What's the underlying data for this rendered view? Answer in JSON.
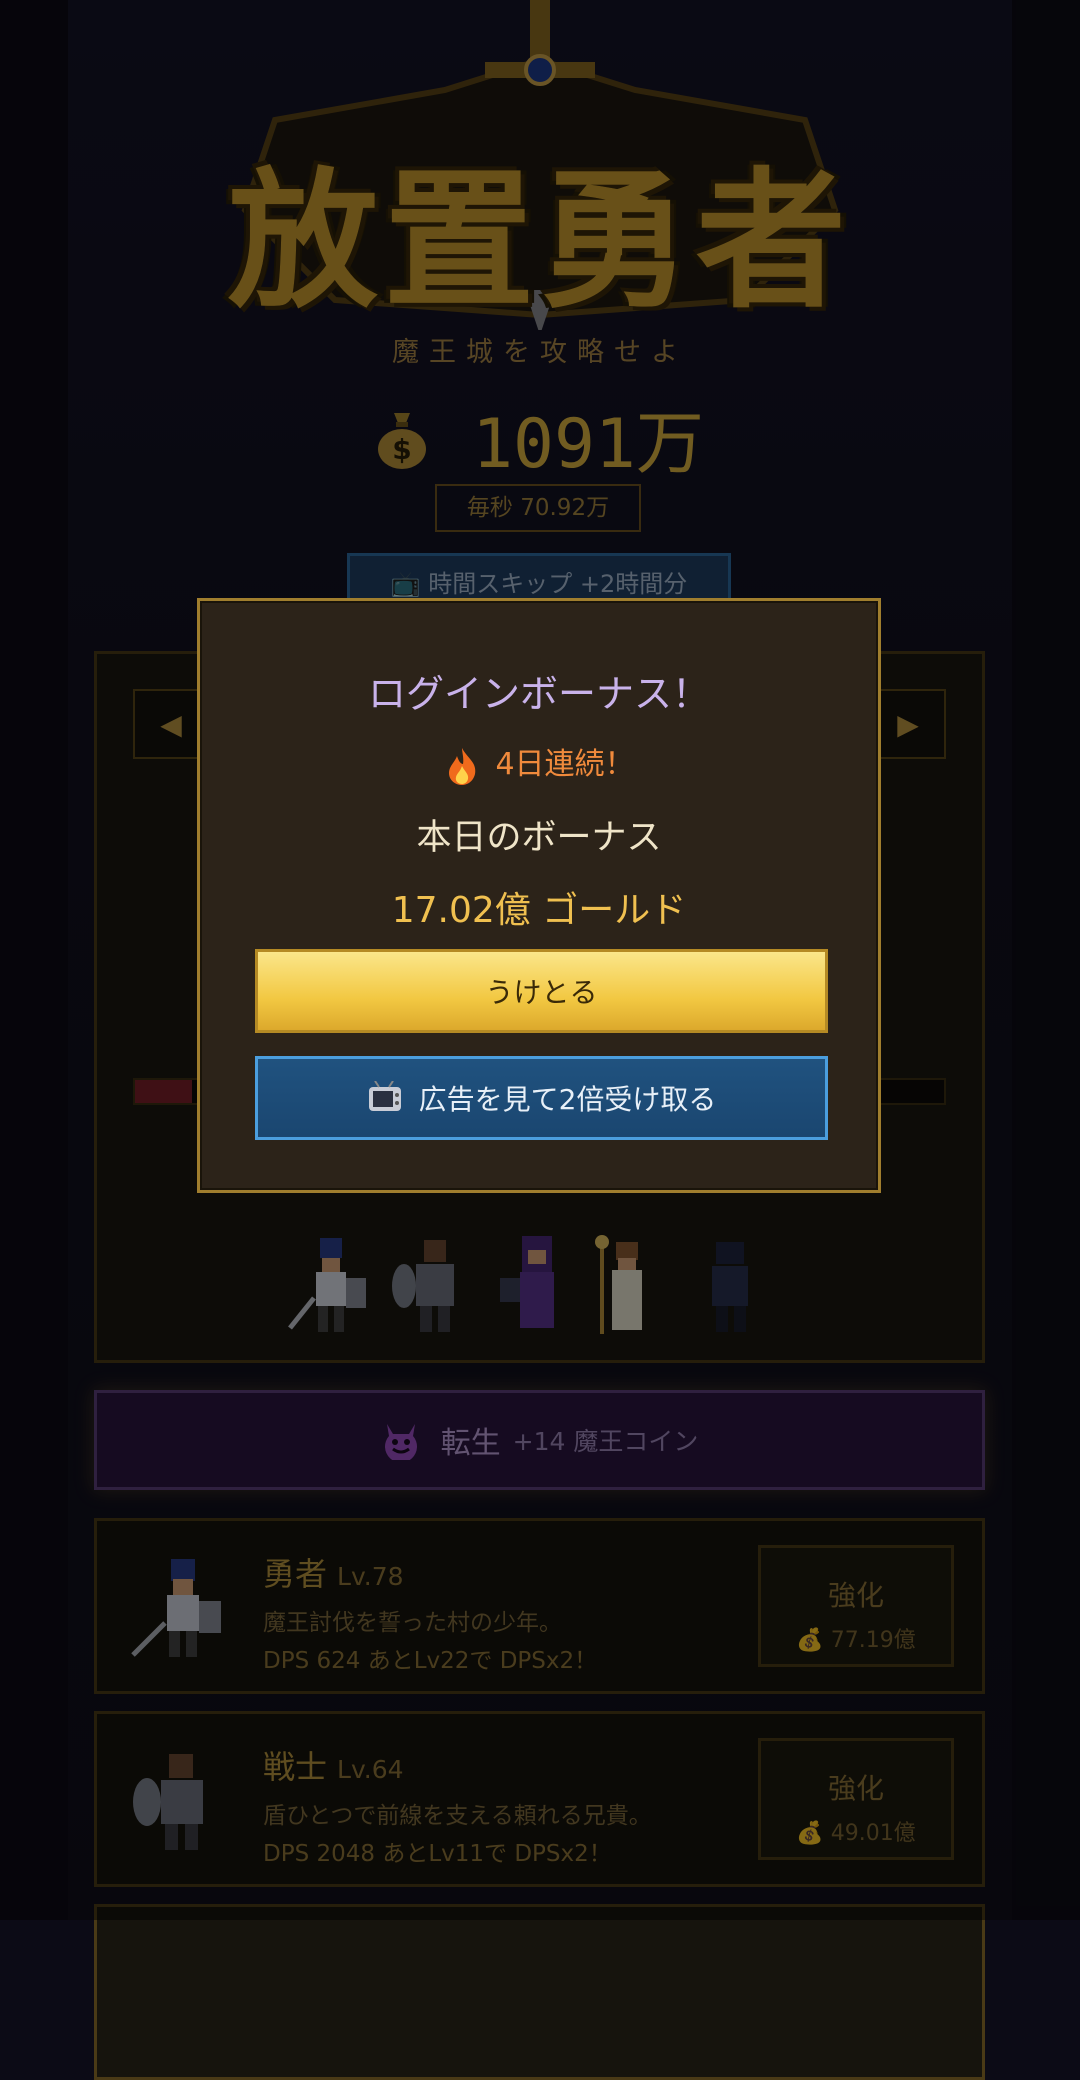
{
  "game": {
    "logo_text": "放置勇者",
    "subtitle": "魔王城を攻略せよ",
    "gold": "1091万",
    "gold_per_sec": "毎秒 70.92万",
    "skip_button": "時間スキップ +2時間分"
  },
  "hp_fraction": 0.07,
  "rebirth": {
    "label": "転生",
    "coins": "+14 魔王コイン"
  },
  "units": [
    {
      "name": "勇者",
      "level": "Lv.78",
      "description": "魔王討伐を誓った村の少年。",
      "dps": "DPS 624  あとLv22で DPSx2！",
      "boost_label": "強化",
      "boost_cost": "77.19億"
    },
    {
      "name": "戦士",
      "level": "Lv.64",
      "description": "盾ひとつで前線を支える頼れる兄貴。",
      "dps": "DPS 2048  あとLv11で DPSx2！",
      "boost_label": "強化",
      "boost_cost": "49.01億"
    }
  ],
  "modal": {
    "title": "ログインボーナス！",
    "streak": "4日連続！",
    "today_label": "本日のボーナス",
    "amount": "17.02億 ゴールド",
    "claim_button": "うけとる",
    "ad_button": "広告を見て2倍受け取る"
  },
  "icons": {
    "gold": "money-bag-icon",
    "skip": "tv-icon",
    "rebirth": "devil-icon",
    "streak": "fire-icon",
    "ad": "tv-icon"
  },
  "colors": {
    "accent_gold": "#d8b040",
    "rebirth_purple": "#2b1640",
    "claim_yellow": "#f2c842",
    "ad_blue": "#1a4670"
  }
}
